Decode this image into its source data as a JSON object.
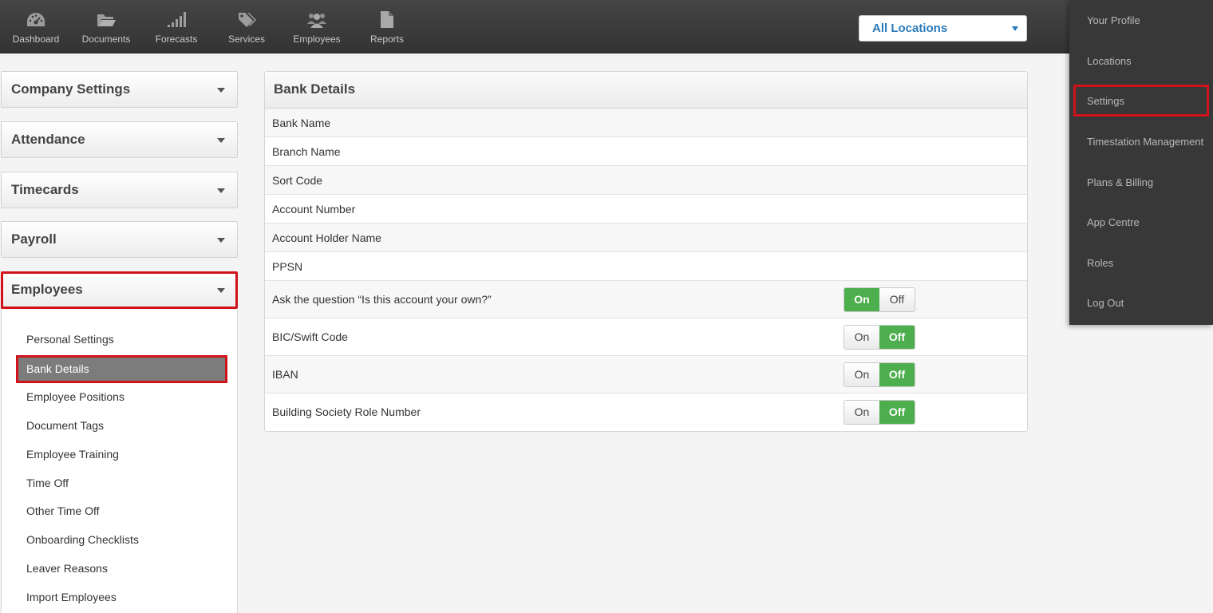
{
  "nav": {
    "items": [
      {
        "label": "Dashboard",
        "icon": "dashboard-icon"
      },
      {
        "label": "Documents",
        "icon": "folder-icon"
      },
      {
        "label": "Forecasts",
        "icon": "signal-bars-icon"
      },
      {
        "label": "Services",
        "icon": "tags-icon"
      },
      {
        "label": "Employees",
        "icon": "users-icon"
      },
      {
        "label": "Reports",
        "icon": "document-icon"
      }
    ],
    "location": "All Locations"
  },
  "sidebar": {
    "sections": [
      "Company Settings",
      "Attendance",
      "Timecards",
      "Payroll",
      "Employees"
    ],
    "submenu": [
      "Personal Settings",
      "Bank Details",
      "Employee Positions",
      "Document Tags",
      "Employee Training",
      "Time Off",
      "Other Time Off",
      "Onboarding Checklists",
      "Leaver Reasons",
      "Import Employees"
    ],
    "active_submenu": "Bank Details"
  },
  "panel": {
    "title": "Bank Details",
    "fields": [
      "Bank Name",
      "Branch Name",
      "Sort Code",
      "Account Number",
      "Account Holder Name",
      "PPSN"
    ],
    "toggles": [
      {
        "label": "Ask the question “Is this account your own?”",
        "on": "On",
        "off": "Off",
        "state": "on"
      },
      {
        "label": "BIC/Swift Code",
        "on": "On",
        "off": "Off",
        "state": "off"
      },
      {
        "label": "IBAN",
        "on": "On",
        "off": "Off",
        "state": "off"
      },
      {
        "label": "Building Society Role Number",
        "on": "On",
        "off": "Off",
        "state": "off"
      }
    ]
  },
  "user_menu": {
    "items": [
      "Your Profile",
      "Locations",
      "Settings",
      "Timestation Management",
      "Plans & Billing",
      "App Centre",
      "Roles",
      "Log Out"
    ],
    "highlighted": "Settings"
  },
  "colors": {
    "accent": "#2a7ab8",
    "toggle_active": "#4cae4c",
    "highlight": "#d0121b",
    "topbar": "#3a3a3a"
  }
}
